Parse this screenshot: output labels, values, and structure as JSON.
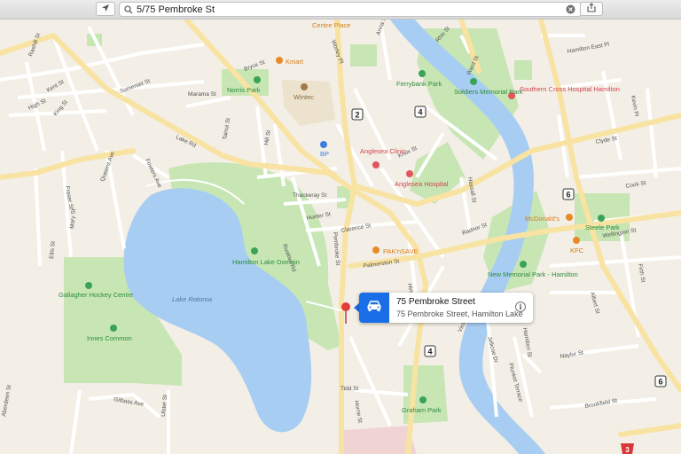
{
  "toolbar": {
    "search_value": "5/75 Pembroke St",
    "location_icon": "location-arrow-icon",
    "search_icon": "search-icon",
    "clear_icon": "clear-icon",
    "share_icon": "share-icon"
  },
  "callout": {
    "title": "75 Pembroke Street",
    "subtitle": "75 Pembroke Street, Hamilton Lake",
    "icon": "car-icon",
    "info_icon": "info-icon",
    "info_glyph": "i",
    "accent": "#1a6ee8"
  },
  "colors": {
    "land": "#f3efe6",
    "park": "#c7e6b4",
    "water": "#a7cdf2",
    "road": "#ffffff",
    "major_road": "#f8e3a3",
    "poi_red": "#e0555e",
    "poi_orange": "#e78a2a",
    "poi_green": "#3aa357",
    "poi_blue": "#3f7ee0",
    "park_text": "#2f8b3e",
    "poi_red_text": "#d4424d",
    "poi_orange_text": "#d97a17"
  },
  "street_labels": [
    {
      "text": "Rashill St"
    },
    {
      "text": "Kent St"
    },
    {
      "text": "High St"
    },
    {
      "text": "King St"
    },
    {
      "text": "Somerset St"
    },
    {
      "text": "Marama St"
    },
    {
      "text": "Bryce St"
    },
    {
      "text": "Worley Pl"
    },
    {
      "text": "Anna St"
    },
    {
      "text": "Rhis St"
    },
    {
      "text": "Lake Rd"
    },
    {
      "text": "Tainui St"
    },
    {
      "text": "Hill St"
    },
    {
      "text": "Queens Ave"
    },
    {
      "text": "Fraser St"
    },
    {
      "text": "Fowlers Ave"
    },
    {
      "text": "Thackeray St"
    },
    {
      "text": "Hunter St"
    },
    {
      "text": "Clarence St"
    },
    {
      "text": "Pembroke St"
    },
    {
      "text": "Ruakiwi Rd"
    },
    {
      "text": "Palmerston St"
    },
    {
      "text": "Knox St"
    },
    {
      "text": "Radnor St"
    },
    {
      "text": "Hassall St"
    },
    {
      "text": "Victoria St"
    },
    {
      "text": "Ward St"
    },
    {
      "text": "Mary St"
    },
    {
      "text": "Ellis St"
    },
    {
      "text": "Clyde St"
    },
    {
      "text": "Cook St"
    },
    {
      "text": "Wellington St"
    },
    {
      "text": "Firth St"
    },
    {
      "text": "Kevin Pl"
    },
    {
      "text": "Albert St"
    },
    {
      "text": "Naylor St"
    },
    {
      "text": "Brookfield St"
    },
    {
      "text": "Gilbass Ave"
    },
    {
      "text": "Tidd St"
    },
    {
      "text": "Horne St"
    },
    {
      "text": "Jellicoe Dr"
    },
    {
      "text": "Plunket Terrace"
    },
    {
      "text": "Aberdeen St"
    },
    {
      "text": "Hamilton St"
    },
    {
      "text": "Hamilton East Pl"
    },
    {
      "text": "Hinemoa St"
    },
    {
      "text": "Ulster St"
    }
  ],
  "places": [
    {
      "text": "Centre Place",
      "kind": "orange"
    },
    {
      "text": "Kmart",
      "kind": "orange"
    },
    {
      "text": "Norris Park",
      "kind": "green"
    },
    {
      "text": "Wintec",
      "kind": "brown"
    },
    {
      "text": "Ferrybank Park",
      "kind": "green"
    },
    {
      "text": "Soldiers Memorial Park",
      "kind": "green"
    },
    {
      "text": "Southern Cross Hospital Hamilton",
      "kind": "red"
    },
    {
      "text": "BP",
      "kind": "blue"
    },
    {
      "text": "Anglesea Clinic",
      "kind": "red"
    },
    {
      "text": "Anglesea Hospital",
      "kind": "red"
    },
    {
      "text": "McDonald's",
      "kind": "orange"
    },
    {
      "text": "KFC",
      "kind": "orange"
    },
    {
      "text": "Steele Park",
      "kind": "green"
    },
    {
      "text": "PAK'nSAVE",
      "kind": "orange"
    },
    {
      "text": "Hamilton Lake Domain",
      "kind": "green"
    },
    {
      "text": "Lake Rotoroa",
      "kind": "water"
    },
    {
      "text": "Gallagher Hockey Centre",
      "kind": "green"
    },
    {
      "text": "Innes Common",
      "kind": "green"
    },
    {
      "text": "New Memorial Park - Hamilton",
      "kind": "green"
    },
    {
      "text": "Graham Park",
      "kind": "green"
    }
  ],
  "route_shields": [
    "2",
    "4",
    "4",
    "6",
    "6",
    "3"
  ]
}
